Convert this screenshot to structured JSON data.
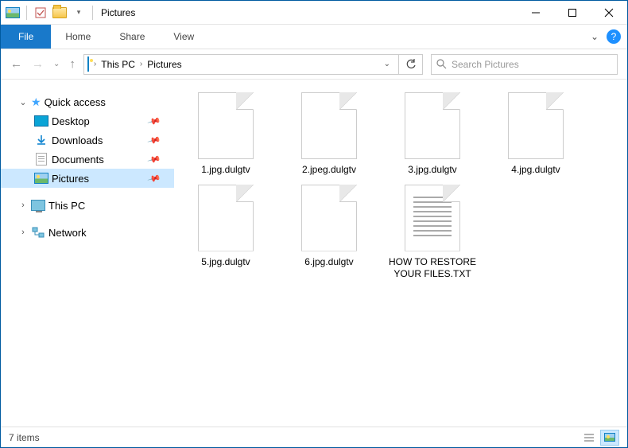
{
  "window": {
    "title": "Pictures"
  },
  "ribbon": {
    "file": "File",
    "home": "Home",
    "share": "Share",
    "view": "View"
  },
  "breadcrumb": {
    "root": "This PC",
    "current": "Pictures"
  },
  "search": {
    "placeholder": "Search Pictures"
  },
  "sidebar": {
    "quick_access": "Quick access",
    "desktop": "Desktop",
    "downloads": "Downloads",
    "documents": "Documents",
    "pictures": "Pictures",
    "this_pc": "This PC",
    "network": "Network"
  },
  "files": [
    {
      "name": "1.jpg.dulgtv",
      "type": "blank"
    },
    {
      "name": "2.jpeg.dulgtv",
      "type": "blank"
    },
    {
      "name": "3.jpg.dulgtv",
      "type": "blank"
    },
    {
      "name": "4.jpg.dulgtv",
      "type": "blank"
    },
    {
      "name": "5.jpg.dulgtv",
      "type": "blank"
    },
    {
      "name": "6.jpg.dulgtv",
      "type": "blank"
    },
    {
      "name": "HOW TO RESTORE YOUR FILES.TXT",
      "type": "txt"
    }
  ],
  "statusbar": {
    "count": "7 items"
  }
}
